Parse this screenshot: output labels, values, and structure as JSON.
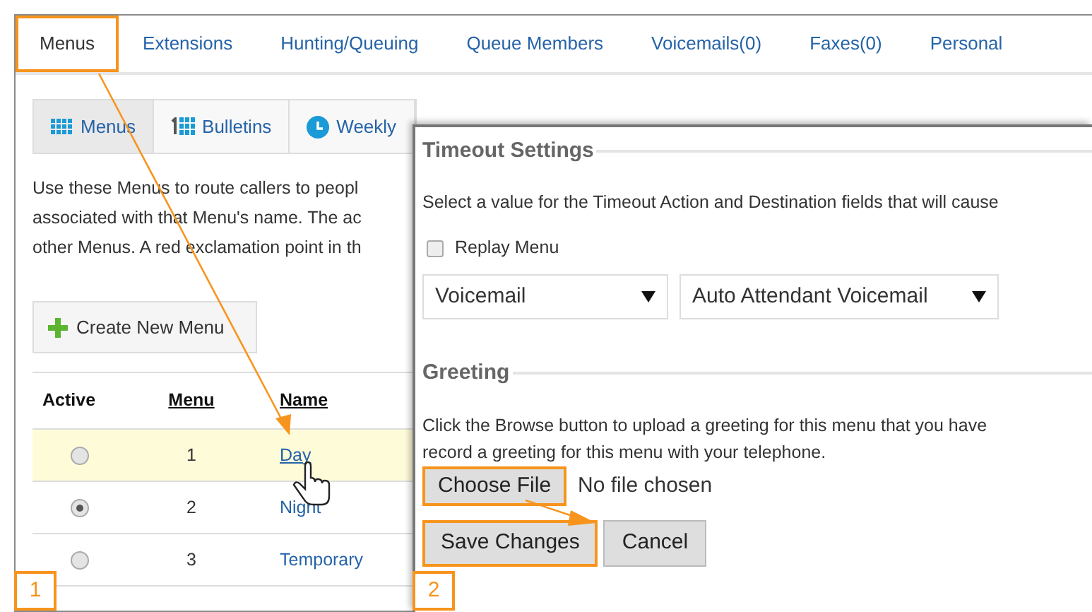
{
  "tabs": [
    {
      "label": "Menus",
      "selected": true,
      "callout": true
    },
    {
      "label": "Extensions",
      "selected": false,
      "callout": false
    },
    {
      "label": "Hunting/Queuing",
      "selected": false,
      "callout": false
    },
    {
      "label": "Queue Members",
      "selected": false,
      "callout": false
    },
    {
      "label": "Voicemails(0)",
      "selected": false,
      "callout": false
    },
    {
      "label": "Faxes(0)",
      "selected": false,
      "callout": false
    },
    {
      "label": "Personal",
      "selected": false,
      "callout": false
    }
  ],
  "sub_tabs": [
    {
      "label": "Menus",
      "selected": true
    },
    {
      "label": "Bulletins",
      "selected": false
    },
    {
      "label": "Weekly",
      "selected": false
    }
  ],
  "description_lines": [
    "Use these Menus to route callers to peopl",
    "associated with that Menu's name. The ac",
    "other Menus. A red exclamation point in th"
  ],
  "create_button": "Create New Menu",
  "table": {
    "columns": [
      "Active",
      "Menu",
      "Name"
    ],
    "rows": [
      {
        "active": false,
        "menu": "1",
        "name": "Day",
        "highlighted": true
      },
      {
        "active": true,
        "menu": "2",
        "name": "Night",
        "highlighted": false
      },
      {
        "active": false,
        "menu": "3",
        "name": "Temporary",
        "highlighted": false
      }
    ]
  },
  "dialog": {
    "timeout_settings": {
      "legend": "Timeout Settings",
      "text": "Select a value for the Timeout Action and Destination fields that will cause",
      "replay_menu": {
        "label": "Replay Menu",
        "checked": false
      },
      "action": "Voicemail",
      "destination": "Auto Attendant Voicemail"
    },
    "greeting": {
      "legend": "Greeting",
      "text_lines": [
        "Click the Browse button to upload a greeting for this menu that you have",
        "record a greeting for this menu with your telephone."
      ],
      "file_button": {
        "label": "Choose File",
        "callout": true
      },
      "file_status": "No file chosen"
    },
    "buttons": [
      {
        "label": "Save Changes",
        "callout": true
      },
      {
        "label": "Cancel",
        "callout": false
      }
    ]
  },
  "step_labels": [
    "1",
    "2"
  ]
}
